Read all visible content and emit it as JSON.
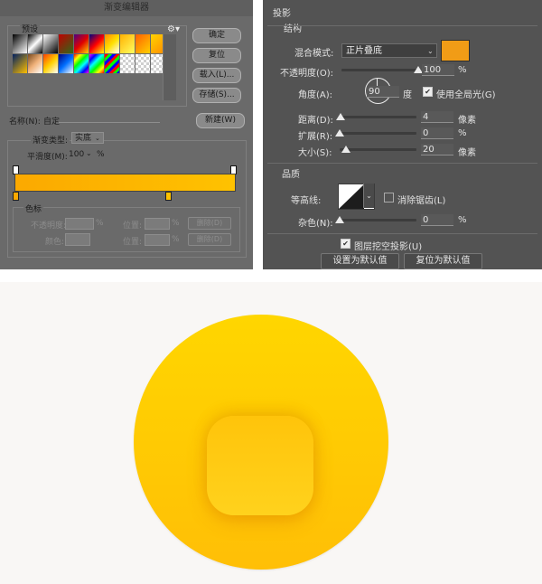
{
  "gradient_editor": {
    "title": "渐变编辑器",
    "close_glyph": "✕",
    "presets_label": "预设",
    "gear_icon": "gear-icon",
    "buttons": {
      "ok": "确定",
      "reset": "复位",
      "load": "载入(L)...",
      "save": "存储(S)...",
      "new": "新建(W)"
    },
    "name_label": "名称(N):",
    "name_value": "自定",
    "gradient_type_label": "渐变类型:",
    "gradient_type_value": "实底",
    "smoothness_label": "平滑度(M):",
    "smoothness_value": "100",
    "smoothness_unit": "%",
    "gradient_colors": [
      "#fca900",
      "#fec200"
    ],
    "color_stops_label": "色标",
    "opacity_label": "不透明度:",
    "location_label": "位置:",
    "percent": "%",
    "delete_label": "删除(D)",
    "color_label": "颜色:"
  },
  "drop_shadow": {
    "title": "投影",
    "structure_label": "结构",
    "blend_mode_label": "混合模式:",
    "blend_mode_value": "正片叠底",
    "shadow_color": "#f19c16",
    "opacity_label": "不透明度(O):",
    "opacity_value": "100",
    "opacity_percent": 100,
    "percent": "%",
    "angle_label": "角度(A):",
    "angle_value": "90",
    "angle_unit": "度",
    "global_light_label": "使用全局光(G)",
    "global_light_checked": true,
    "distance_label": "距离(D):",
    "distance_value": "4",
    "spread_label": "扩展(R):",
    "spread_value": "0",
    "size_label": "大小(S):",
    "size_value": "20",
    "pixels": "像素",
    "quality_label": "品质",
    "contour_label": "等高线:",
    "anti_alias_label": "消除锯齿(L)",
    "anti_alias_checked": false,
    "noise_label": "杂色(N):",
    "noise_value": "0",
    "knockout_label": "图层挖空投影(U)",
    "knockout_checked": true,
    "make_default_label": "设置为默认值",
    "reset_default_label": "复位为默认值"
  },
  "artwork": {
    "circle_colors": [
      "#ffd600",
      "#ffbf06"
    ],
    "square_colors": [
      "#ffc40a",
      "#ffd21d"
    ]
  }
}
